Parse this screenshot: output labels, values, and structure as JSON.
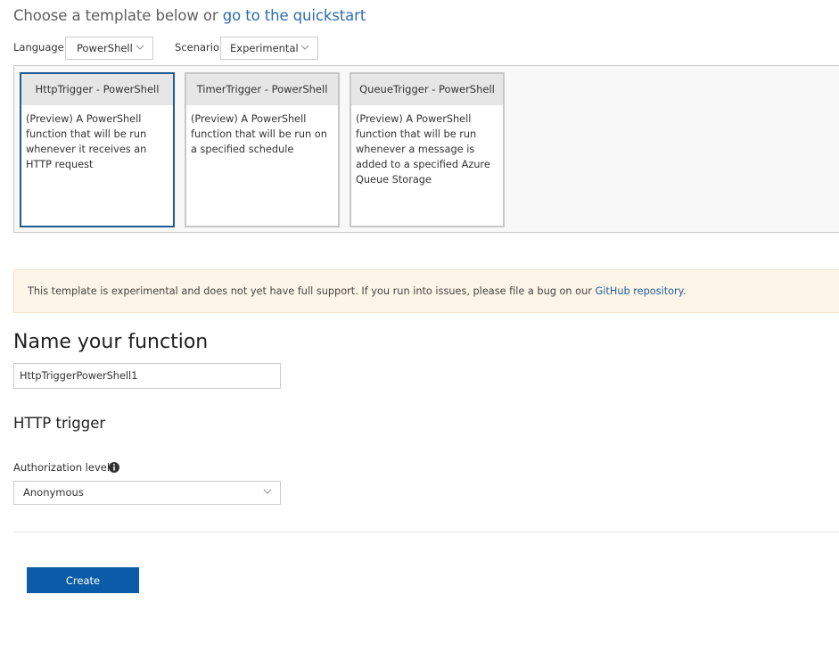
{
  "heading": {
    "prefix": "Choose a template below or ",
    "link": "go to the quickstart"
  },
  "filters": {
    "language": {
      "label": "Language:",
      "value": "PowerShell"
    },
    "scenario": {
      "label": "Scenario:",
      "value": "Experimental"
    }
  },
  "templates": [
    {
      "title": "HttpTrigger - PowerShell",
      "description": "(Preview) A PowerShell function that will be run whenever it receives an HTTP request",
      "selected": true
    },
    {
      "title": "TimerTrigger - PowerShell",
      "description": "(Preview) A PowerShell function that will be run on a specified schedule",
      "selected": false
    },
    {
      "title": "QueueTrigger - PowerShell",
      "description": "(Preview) A PowerShell function that will be run whenever a message is added to a specified Azure Queue Storage",
      "selected": false
    }
  ],
  "warning": {
    "text": "This template is experimental and does not yet have full support. If you run into issues, please file a bug on our ",
    "link": "GitHub repository",
    "suffix": "."
  },
  "name_section": {
    "title": "Name your function",
    "value": "HttpTriggerPowerShell1"
  },
  "trigger_section": {
    "title": "HTTP trigger"
  },
  "authorization": {
    "label": "Authorization level",
    "value": "Anonymous",
    "icon": "info-icon"
  },
  "actions": {
    "create_label": "Create"
  },
  "colors": {
    "accent": "#0b5ca8",
    "selected_border": "#1e5c94",
    "warning_bg": "#fdf6e8",
    "link": "#1f5b98"
  }
}
